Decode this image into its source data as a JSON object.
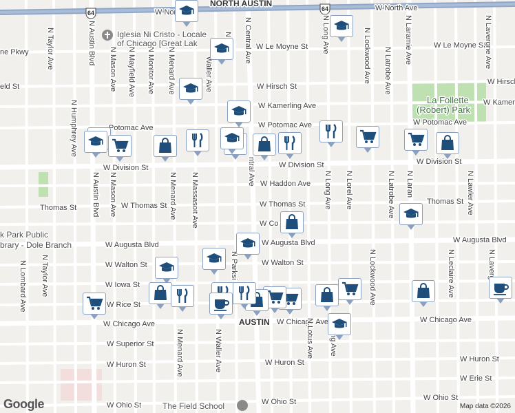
{
  "map": {
    "neighborhood_label": "AUSTIN",
    "attribution": "Map data ©2026",
    "logo": "Google",
    "highway_shield": "64",
    "colors": {
      "road_fill": "#ffffff",
      "highway": "#8fa7c7",
      "park": "#bfe0b0",
      "pin_icon": "#1f4e7a"
    }
  },
  "streets": {
    "north_ave_w": "W North Ave",
    "north_austin": "NORTH AUSTIN",
    "north_ave_e": "W North Ave",
    "le_moyne_w": "ne Pkwy",
    "le_moyne": "W Le Moyne St",
    "le_moyne_e": "W Le Moyne St",
    "hirsch_w": "eld St",
    "hirsch": "W Hirsch St",
    "hirsch_e": "W Hirsch",
    "kamerling": "W Kamerling Ave",
    "kamerling_e": "W Kamerlin",
    "potomac_w": "Potomac Ave",
    "potomac": "W Potomac Ave",
    "potomac_e": "W Potomac Ave",
    "division_w": "W Division St",
    "division": "W Division St",
    "division_e": "W Division St",
    "haddon": "W Haddon Ave",
    "thomas_ww": "Thomas St",
    "thomas_w": "W Thomas St",
    "thomas": "W Thomas St",
    "thomas_e": "Thomas St",
    "cortez": "W Co",
    "augusta_w": "W Augusta Blvd",
    "augusta": "W Augusta Blvd",
    "augusta_e": "W Augusta Blvd",
    "walton_w": "W Walton St",
    "walton": "W Walton St",
    "iowa": "W Iowa St",
    "rice": "W Rice St",
    "chicago_w": "W Chicago Ave",
    "chicago": "W Chicago Ave",
    "chicago_e": "W Chicago Ave",
    "superior": "W Superior St",
    "huron": "W Huron St",
    "huron_w": "W Huron St",
    "huron_e": "W Huron St",
    "erie": "W Erie St",
    "ohio_w": "W Ohio St",
    "ohio": "W Ohio St",
    "ohio_e": "W Ohio St",
    "taylor_n": "N Taylor Ave",
    "taylor_s": "N Taylor Ave",
    "humphrey": "N Humphrey Ave",
    "lombard": "N Lombard Ave",
    "austin_n": "N Austin Blvd",
    "austin_s": "N Austin Blvd",
    "mason_n": "N Mason Ave",
    "mason_s": "N Mason Ave",
    "mayfield": "N Mayfield Ave",
    "monitor": "N Monitor Ave",
    "menard_n": "N Menard Ave",
    "menard_m": "N Menard Ave",
    "menard_s": "N Menard Ave",
    "massasoit": "N Massasoit Ave",
    "waller_n": "Waller Ave",
    "waller_s": "N Waller Ave",
    "parkside_n": "N Pa",
    "parkside_s": "N Parksi",
    "central_n": "N Central Ave",
    "central_m": "ntral Ave",
    "long_n": "N Long Ave",
    "long_m": "N Long Ave",
    "long_s": "ong Ave",
    "lotus": "N Lotus Ave",
    "lockwood_n": "N Lockwood Ave",
    "lockwood_s": "N Lockwood Ave",
    "latrobe_n": "N Latrobe Ave",
    "latrobe_s": "N Latrobe Ave",
    "lorel": "N Lorel Ave",
    "laramie_n": "N Laramie Ave",
    "laramie_s": "N Laran",
    "lawler": "N Lawler Ave",
    "leclaire": "N Leclaire Ave",
    "lavergne_n": "N Lavergne Ave",
    "lavergne_s": "N Lavergn"
  },
  "places": {
    "church_line1": "Iglesia Ni Cristo - Locale",
    "church_line2": "of Chicago [Great Lak",
    "library_line1": "k Park Public",
    "library_line2": "brary - Dole Branch",
    "park_line1": "La Follette",
    "park_line2": "(Robert) Park",
    "school": "The Field School"
  },
  "markers": [
    {
      "type": "school",
      "icon": "graduation-cap-icon"
    },
    {
      "type": "school",
      "icon": "graduation-cap-icon"
    },
    {
      "type": "school",
      "icon": "graduation-cap-icon"
    },
    {
      "type": "school",
      "icon": "graduation-cap-icon"
    },
    {
      "type": "school",
      "icon": "graduation-cap-icon"
    },
    {
      "type": "school",
      "icon": "graduation-cap-icon"
    },
    {
      "type": "school",
      "icon": "graduation-cap-icon"
    },
    {
      "type": "school",
      "icon": "graduation-cap-icon"
    },
    {
      "type": "school",
      "icon": "graduation-cap-icon"
    },
    {
      "type": "school",
      "icon": "graduation-cap-icon"
    },
    {
      "type": "school",
      "icon": "graduation-cap-icon"
    },
    {
      "type": "school",
      "icon": "graduation-cap-icon"
    },
    {
      "type": "school",
      "icon": "graduation-cap-icon"
    },
    {
      "type": "school",
      "icon": "graduation-cap-icon"
    },
    {
      "type": "grocery",
      "icon": "shopping-cart-icon"
    },
    {
      "type": "grocery",
      "icon": "shopping-cart-icon"
    },
    {
      "type": "grocery",
      "icon": "shopping-cart-icon"
    },
    {
      "type": "grocery",
      "icon": "shopping-cart-icon"
    },
    {
      "type": "grocery",
      "icon": "shopping-cart-icon"
    },
    {
      "type": "grocery",
      "icon": "shopping-cart-icon"
    },
    {
      "type": "grocery",
      "icon": "shopping-cart-icon"
    },
    {
      "type": "shopping",
      "icon": "shopping-bag-icon"
    },
    {
      "type": "shopping",
      "icon": "shopping-bag-icon"
    },
    {
      "type": "shopping",
      "icon": "shopping-bag-icon"
    },
    {
      "type": "shopping",
      "icon": "shopping-bag-icon"
    },
    {
      "type": "shopping",
      "icon": "shopping-bag-icon"
    },
    {
      "type": "shopping",
      "icon": "shopping-bag-icon"
    },
    {
      "type": "shopping",
      "icon": "shopping-bag-icon"
    },
    {
      "type": "shopping",
      "icon": "shopping-bag-icon"
    },
    {
      "type": "restaurant",
      "icon": "fork-knife-icon"
    },
    {
      "type": "restaurant",
      "icon": "fork-knife-icon"
    },
    {
      "type": "restaurant",
      "icon": "fork-knife-icon"
    },
    {
      "type": "restaurant",
      "icon": "fork-knife-icon"
    },
    {
      "type": "restaurant",
      "icon": "fork-knife-icon"
    },
    {
      "type": "restaurant",
      "icon": "fork-knife-icon"
    },
    {
      "type": "cafe",
      "icon": "coffee-cup-icon"
    },
    {
      "type": "cafe",
      "icon": "coffee-cup-icon"
    }
  ]
}
